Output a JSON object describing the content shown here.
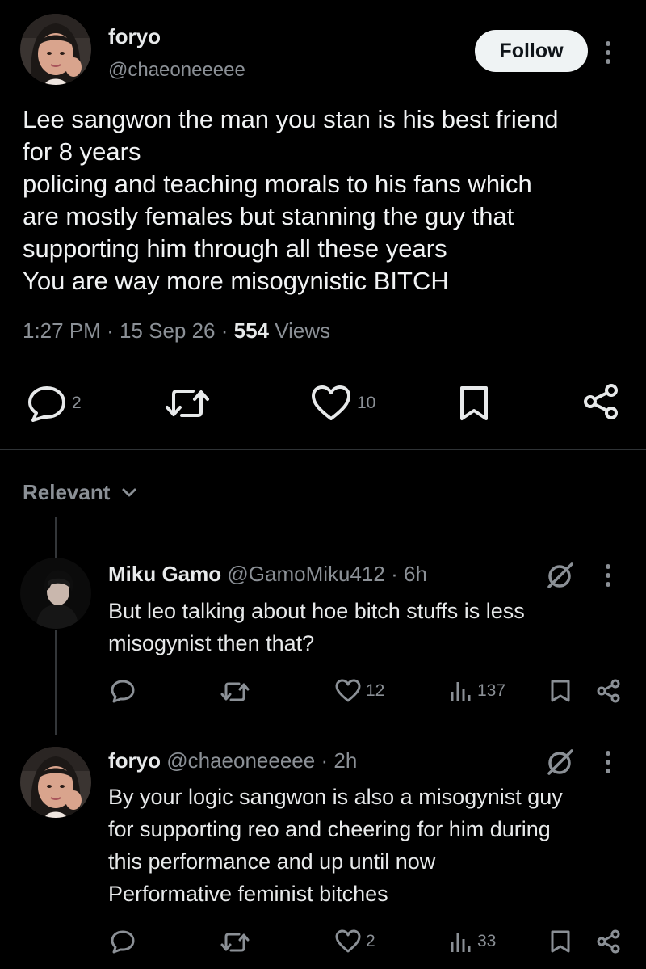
{
  "post": {
    "author_name": "foryo",
    "author_handle": "@chaeoneeeee",
    "follow_label": "Follow",
    "text_lines": [
      "Lee sangwon the man you stan is his best friend",
      "for 8 years",
      "policing and teaching morals to his fans which",
      "are mostly females but stanning the guy that",
      "supporting him through all these years",
      "You are way more misogynistic BITCH"
    ],
    "time": "1:27 PM",
    "date": "15 Sep 26",
    "views_count": "554",
    "views_label": "Views",
    "replies": "2",
    "likes": "10"
  },
  "sort": {
    "label": "Relevant"
  },
  "replies": [
    {
      "name": "Miku Gamo",
      "handle": "@GamoMiku412",
      "age": "6h",
      "text_lines": [
        "But leo talking about hoe bitch stuffs is less",
        "misogynist then that?"
      ],
      "likes": "12",
      "views": "137"
    },
    {
      "name": "foryo",
      "handle": "@chaeoneeeee",
      "age": "2h",
      "text_lines": [
        "By your logic sangwon is also a misogynist guy",
        "for supporting reo and cheering for him during",
        "this performance and up until now",
        "Performative feminist bitches"
      ],
      "likes": "2",
      "views": "33"
    }
  ],
  "colors": {
    "background": "#000000",
    "text": "#e7e9ea",
    "muted": "#8b9096",
    "button_bg": "#eff3f4"
  }
}
